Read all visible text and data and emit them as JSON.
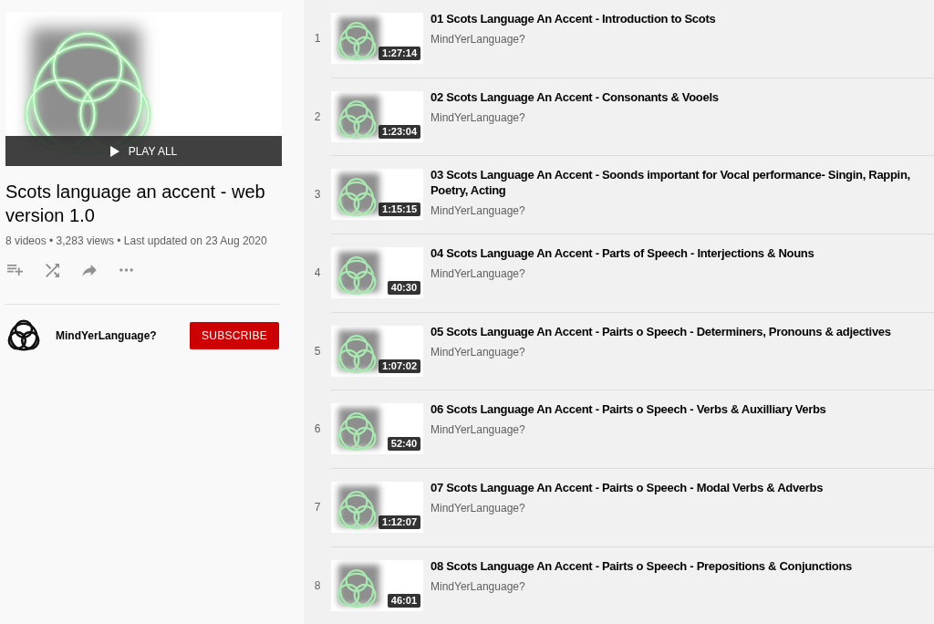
{
  "playlist": {
    "play_all": "PLAY ALL",
    "title": "Scots language an accent - web version 1.0",
    "stats": "8 videos • 3,283 views • Last updated on 23 Aug 2020"
  },
  "channel": {
    "name": "MindYerLanguage?",
    "subscribe": "SUBSCRIBE"
  },
  "videos": [
    {
      "index": "1",
      "title": "01 Scots Language An Accent - Introduction to Scots",
      "channel": "MindYerLanguage?",
      "duration": "1:27:14"
    },
    {
      "index": "2",
      "title": "02 Scots Language An Accent - Consonants & Vooels",
      "channel": "MindYerLanguage?",
      "duration": "1:23:04"
    },
    {
      "index": "3",
      "title": "03 Scots Language An Accent - Soonds important for Vocal performance- Singin, Rappin, Poetry, Acting",
      "channel": "MindYerLanguage?",
      "duration": "1:15:15"
    },
    {
      "index": "4",
      "title": "04 Scots Language An Accent - Parts of Speech - Interjections & Nouns",
      "channel": "MindYerLanguage?",
      "duration": "40:30"
    },
    {
      "index": "5",
      "title": "05 Scots Language An Accent - Pairts o Speech - Determiners, Pronouns & adjectives",
      "channel": "MindYerLanguage?",
      "duration": "1:07:02"
    },
    {
      "index": "6",
      "title": "06 Scots Language An Accent - Pairts o Speech - Verbs & Auxilliary Verbs",
      "channel": "MindYerLanguage?",
      "duration": "52:40"
    },
    {
      "index": "7",
      "title": "07 Scots Language An Accent - Pairts o Speech - Modal Verbs & Adverbs",
      "channel": "MindYerLanguage?",
      "duration": "1:12:07"
    },
    {
      "index": "8",
      "title": "08 Scots Language An Accent - Pairts o Speech - Prepositions & Conjunctions",
      "channel": "MindYerLanguage?",
      "duration": "46:01"
    }
  ]
}
